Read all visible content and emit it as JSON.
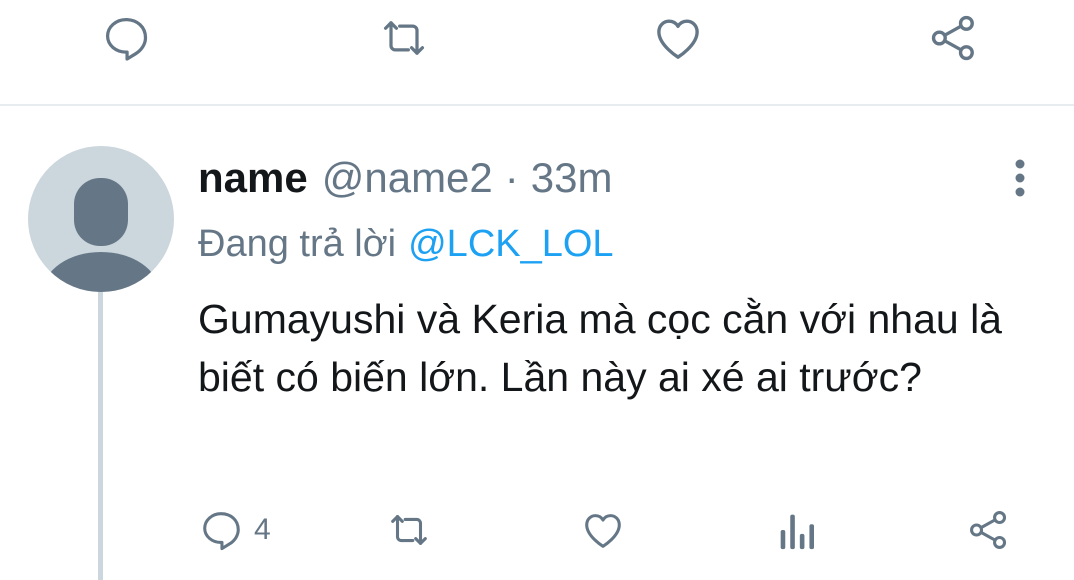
{
  "tweet": {
    "display_name": "name",
    "handle": "@name2",
    "separator": "·",
    "time": "33m",
    "reply_prefix": "Đang trả lời",
    "reply_to": "@LCK_LOL",
    "text": "Gumayushi và Keria mà cọc cằn với nhau là biết có biến lớn. Lần này ai xé ai trước?",
    "reply_count": "4"
  },
  "colors": {
    "icon": "#657786",
    "accent": "#1da1f2",
    "divider": "#e6ecf0",
    "avatar_bg": "#ccd6dd",
    "avatar_fg": "#657786"
  },
  "icons": {
    "reply": "reply-icon",
    "retweet": "retweet-icon",
    "like": "heart-icon",
    "share": "share-icon",
    "analytics": "analytics-icon",
    "more": "more-vertical-icon"
  }
}
